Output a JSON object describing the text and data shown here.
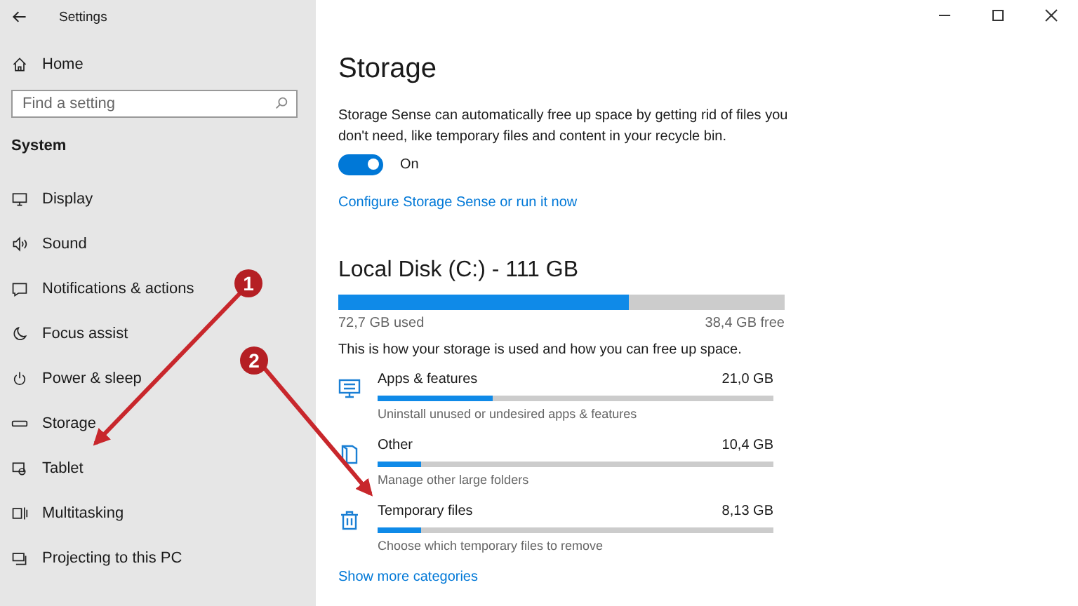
{
  "window": {
    "title": "Settings"
  },
  "sidebar": {
    "home": "Home",
    "search": {
      "placeholder": "Find a setting"
    },
    "section": "System",
    "items": [
      {
        "label": "Display"
      },
      {
        "label": "Sound"
      },
      {
        "label": "Notifications & actions"
      },
      {
        "label": "Focus assist"
      },
      {
        "label": "Power & sleep"
      },
      {
        "label": "Storage"
      },
      {
        "label": "Tablet"
      },
      {
        "label": "Multitasking"
      },
      {
        "label": "Projecting to this PC"
      }
    ]
  },
  "main": {
    "title": "Storage",
    "description": "Storage Sense can automatically free up space by getting rid of files you don't need, like temporary files and content in your recycle bin.",
    "storage_sense": {
      "on": true,
      "label": "On"
    },
    "link": "Configure Storage Sense or run it now",
    "disk": {
      "name": "Local Disk (C:) - 111 GB",
      "level": 0.65,
      "used": "72,7 GB used",
      "free": "38,4 GB free"
    },
    "intro": "This is how your storage is used and how you can free up space.",
    "categories": [
      {
        "name": "Apps & features",
        "size": "21,0 GB",
        "level": 0.29,
        "hint": "Uninstall unused or undesired apps & features"
      },
      {
        "name": "Other",
        "size": "10,4 GB",
        "level": 0.11,
        "hint": "Manage other large folders"
      },
      {
        "name": "Temporary files",
        "size": "8,13 GB",
        "level": 0.11,
        "hint": "Choose which temporary files to remove"
      }
    ],
    "more_link": "Show more categories"
  },
  "annotations": [
    {
      "number": "1"
    },
    {
      "number": "2"
    }
  ]
}
